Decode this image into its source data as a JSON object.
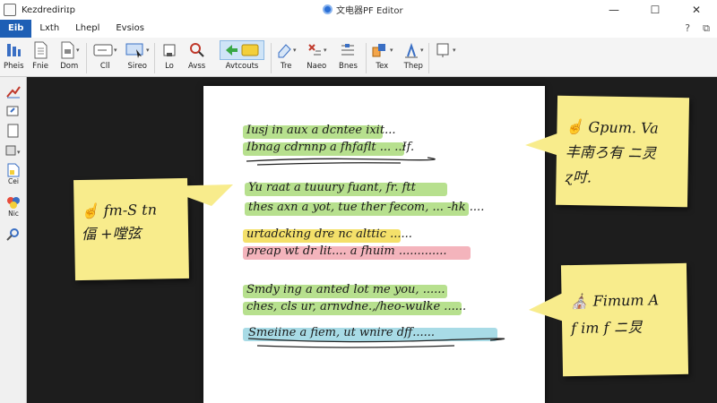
{
  "window": {
    "left_title": "Kezdrediriɪp",
    "center_title": "文电器PF Editor",
    "minimize_label": "—",
    "maximize_label": "☐",
    "close_label": "✕"
  },
  "menu": {
    "tabs": [
      "Eib",
      "Lxth",
      "Lhepl",
      "Evsios"
    ],
    "right_icons": [
      "?",
      "⧉"
    ]
  },
  "ribbon": {
    "buttons": [
      "Pheis",
      "Fnie",
      "Dom",
      "Cll",
      "Sireo",
      "Lo",
      "Avss",
      "Avtcouts",
      "Tre",
      "Naeo",
      "Bnes",
      "Tex",
      "Thep",
      ""
    ]
  },
  "left_toolbar": {
    "labels": [
      "Cei",
      "Nic"
    ]
  },
  "document": {
    "lines": [
      "Iusj in aux a dcntee ixit...",
      "Ibnag cdrnnp a fhfaflt ... ..Ɨf.",
      "Yu raat a tuuury fuant, fr. ftt",
      "thes axn a yot, tue ther fecom, ... -hk ....",
      "urtadcking dre nc alttic ......",
      "preap wt dr lit.... a fhuim .............",
      "Smdy ing a anted lot me you, ......",
      "ches, cls ur, arnvdne.,/heo-wulke ......",
      "Smeiine a fiem, ut wnire dff......"
    ],
    "highlight_colors": {
      "green": "#b7e08e",
      "yellow": "#f4e06a",
      "pink": "#f4b4bc",
      "blue": "#a8dbe6"
    }
  },
  "notes": [
    {
      "line1": "☝ fm-S tn",
      "line2": "偪 +嘡弦"
    },
    {
      "line1": "☝ Gpum. Va",
      "line2": "丰南ろ有 ニ灵",
      "line3": "ɀ吋."
    },
    {
      "line1": "⛪ Fimum A",
      "line2": "f im f ニ炅"
    }
  ]
}
